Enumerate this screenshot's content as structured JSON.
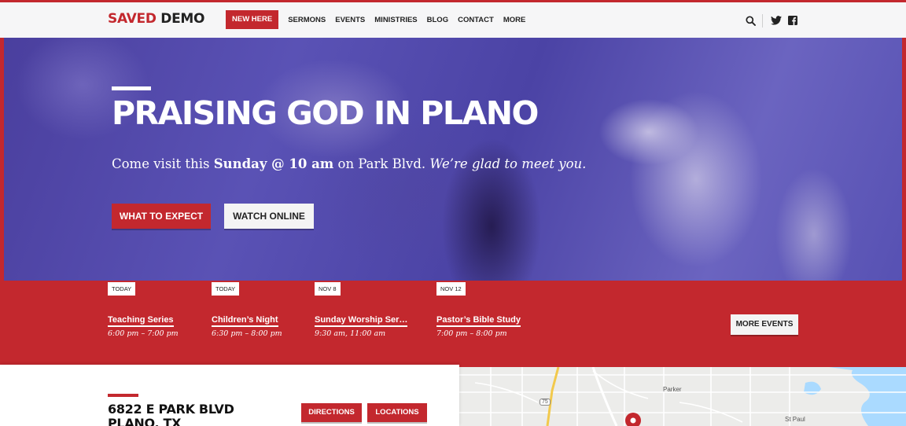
{
  "header": {
    "logo_part1": "SAVED",
    "logo_part2": "DEMO",
    "nav_new": "NEW HERE",
    "nav": [
      {
        "label": "SERMONS"
      },
      {
        "label": "EVENTS"
      },
      {
        "label": "MINISTRIES"
      },
      {
        "label": "BLOG"
      },
      {
        "label": "CONTACT"
      },
      {
        "label": "MORE"
      }
    ]
  },
  "hero": {
    "title": "PRAISING GOD IN PLANO",
    "sub_1": "Come visit this ",
    "sub_bold": "Sunday @ 10 am",
    "sub_2": " on Park Blvd. ",
    "sub_italic": "We’re glad to meet you.",
    "btn_expect": "WHAT TO EXPECT",
    "btn_watch": "WATCH ONLINE"
  },
  "events": {
    "items": [
      {
        "badge": "TODAY",
        "title": "Teaching Series",
        "time": "6:00 pm – 7:00 pm"
      },
      {
        "badge": "TODAY",
        "title": "Children’s Night",
        "time": "6:30 pm – 8:00 pm"
      },
      {
        "badge": "NOV 8",
        "title": "Sunday Worship Ser…",
        "time": "9:30 am, 11:00 am"
      },
      {
        "badge": "NOV 12",
        "title": "Pastor’s Bible Study",
        "time": "7:00 pm – 8:00 pm"
      }
    ],
    "more_label": "MORE EVENTS"
  },
  "location": {
    "address_line1": "6822 E PARK BLVD",
    "address_line2": "PLANO, TX",
    "btn_directions": "DIRECTIONS",
    "btn_locations": "LOCATIONS"
  },
  "map": {
    "label_parker": "Parker",
    "label_st_paul": "St Paul",
    "label_highway": "75"
  },
  "colors": {
    "accent": "#c3282e",
    "hero_overlay": "#5149ad",
    "header_bg": "#f6f6f7"
  }
}
